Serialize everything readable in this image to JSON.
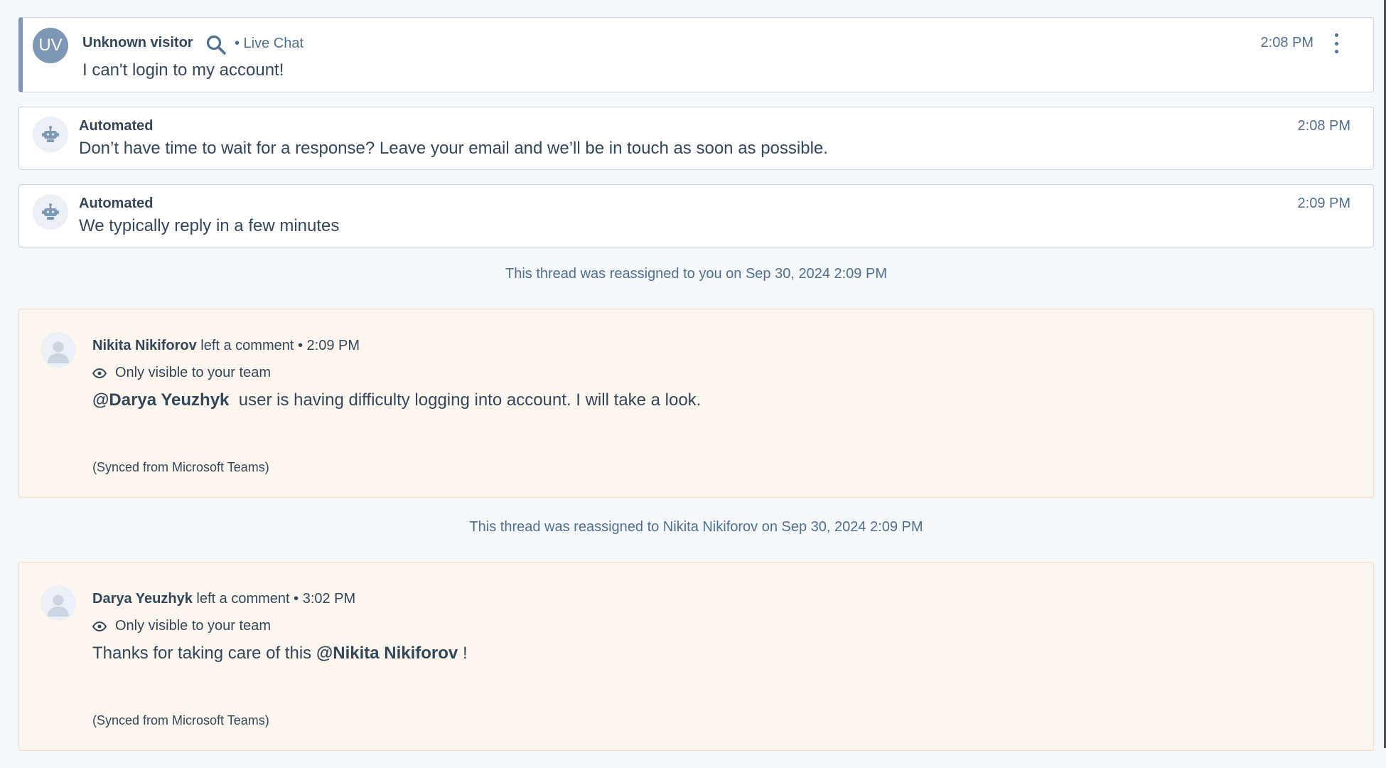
{
  "messages": [
    {
      "avatar_initials": "UV",
      "sender": "Unknown visitor",
      "channel": "• Live Chat",
      "body": "I can't login to my account!",
      "time": "2:08 PM",
      "icons": [
        "search-icon",
        "more-options-icon"
      ]
    },
    {
      "sender": "Automated",
      "body": "Don’t have time to wait for a response? Leave your email and we’ll be in touch as soon as possible.",
      "time": "2:08 PM",
      "icon": "robot-icon"
    },
    {
      "sender": "Automated",
      "body": "We typically reply in a few minutes",
      "time": "2:09 PM",
      "icon": "robot-icon"
    }
  ],
  "system_notes": [
    "This thread was reassigned to you on Sep 30, 2024 2:09 PM",
    "This thread was reassigned to Nikita Nikiforov on Sep 30, 2024 2:09 PM"
  ],
  "comments": [
    {
      "author": "Nikita Nikiforov",
      "action": "left a comment",
      "time": "• 2:09 PM",
      "visibility": "Only visible to your team",
      "mention": "@Darya Yeuzhyk",
      "text_after": "user is having difficulty logging into account. I will take a look.",
      "synced": "(Synced from Microsoft Teams)"
    },
    {
      "author": "Darya Yeuzhyk",
      "action": "left a comment",
      "time": "• 3:02 PM",
      "visibility": "Only visible to your team",
      "text_before": "Thanks for taking care of this",
      "mention": "@Nikita Nikiforov",
      "text_after": "!",
      "synced": "(Synced from Microsoft Teams)"
    }
  ],
  "colors": {
    "background": "#f5f8fa",
    "card_border": "#cbd6e2",
    "visitor_accent": "#7c98b6",
    "comment_background": "#fdf6ef",
    "comment_border": "#f5dcc2",
    "text": "#33475b",
    "muted_text": "#516f90"
  }
}
